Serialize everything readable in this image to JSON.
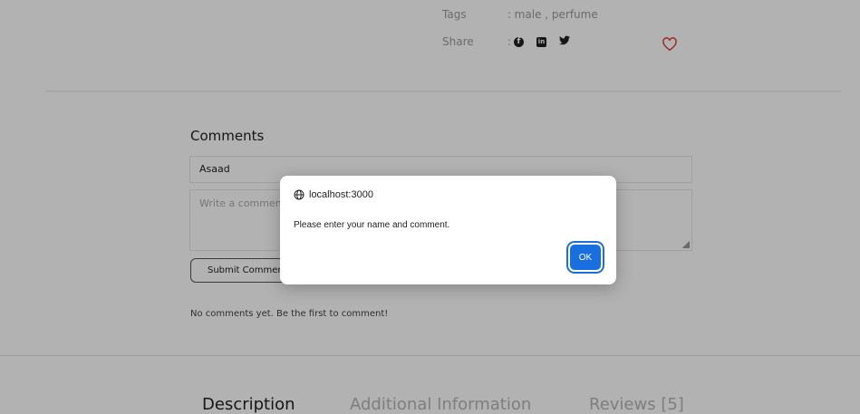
{
  "meta": {
    "tags_label": "Tags",
    "tags_value": ": male , perfume",
    "share_label": "Share",
    "share_sep": ":",
    "share_icons": [
      "facebook-icon",
      "linkedin-icon",
      "twitter-icon"
    ]
  },
  "comments": {
    "title": "Comments",
    "name_value": "Asaad",
    "comment_placeholder": "Write a comment...",
    "submit_label": "Submit Comment",
    "empty_text": "No comments yet. Be the first to comment!"
  },
  "tabs": [
    {
      "label": "Description"
    },
    {
      "label": "Additional Information"
    },
    {
      "label": "Reviews [5]"
    }
  ],
  "dialog": {
    "origin": "localhost:3000",
    "message": "Please enter your name and comment.",
    "ok_label": "OK"
  },
  "colors": {
    "accent": "#1a6fe0",
    "heart": "#e03c3c"
  }
}
